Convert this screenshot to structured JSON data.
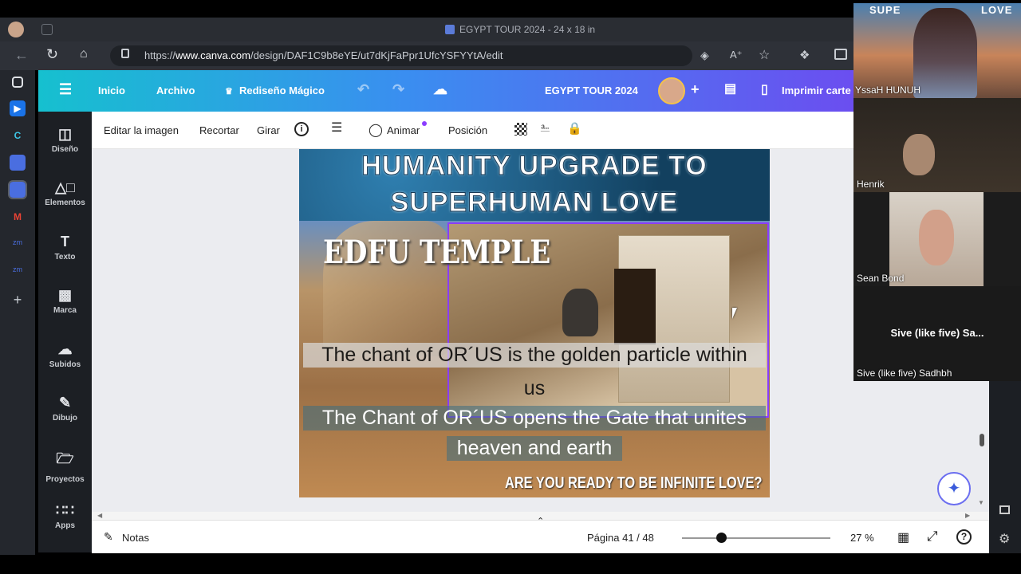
{
  "browser": {
    "window_title": "EGYPT TOUR 2024 - 24 x 18 in",
    "url_prefix": "https://",
    "url_domain": "www.canva.com",
    "url_path": "/design/DAF1C9b8eYE/ut7dKjFaPpr1UfcYSFYYtA/edit"
  },
  "canva": {
    "menu": {
      "home": "Inicio",
      "file": "Archivo",
      "magic": "Rediseño Mágico"
    },
    "project_title": "EGYPT TOUR 2024",
    "print_label": "Imprimir carte"
  },
  "rail": [
    {
      "label": "Diseño",
      "icon": "design-icon"
    },
    {
      "label": "Elementos",
      "icon": "elements-icon"
    },
    {
      "label": "Texto",
      "icon": "text-icon"
    },
    {
      "label": "Marca",
      "icon": "brand-icon"
    },
    {
      "label": "Subidos",
      "icon": "upload-icon"
    },
    {
      "label": "Dibujo",
      "icon": "draw-icon"
    },
    {
      "label": "Proyectos",
      "icon": "folder-icon"
    },
    {
      "label": "Apps",
      "icon": "apps-icon"
    }
  ],
  "toolbar": {
    "edit_image": "Editar la imagen",
    "crop": "Recortar",
    "flip": "Girar",
    "animate": "Animar",
    "position": "Posición"
  },
  "design": {
    "headline_1": "HUMANITY UPGRADE TO",
    "headline_2": "SUPERHUMAN LOVE",
    "temple": "EDFU TEMPLE",
    "chant_1a": "The chant of OR´US is the golden particle within",
    "chant_1b": "us",
    "chant_2a": "The Chant of OR´US opens the Gate that unites",
    "chant_2b": "heaven and earth",
    "question": "ARE YOU READY TO BE INFINITE LOVE?"
  },
  "bottom": {
    "notes": "Notas",
    "page": "Página 41 / 48",
    "zoom": "27 %",
    "zoom_level": 0.27
  },
  "video": {
    "tile1_name": "YssaH HUNUH",
    "tile1_banner_left": "SUPE",
    "tile1_banner_right": "LOVE",
    "tile2_name": "Henrik",
    "tile3_name": "Sean Bond",
    "tile4_center": "Sive (like five) Sa...",
    "tile4_name": "Sive (like five) Sadhbh"
  },
  "colors": {
    "canva_gradient_start": "#16c0cf",
    "canva_gradient_end": "#6b4ef0",
    "selection": "#8b3dff"
  }
}
